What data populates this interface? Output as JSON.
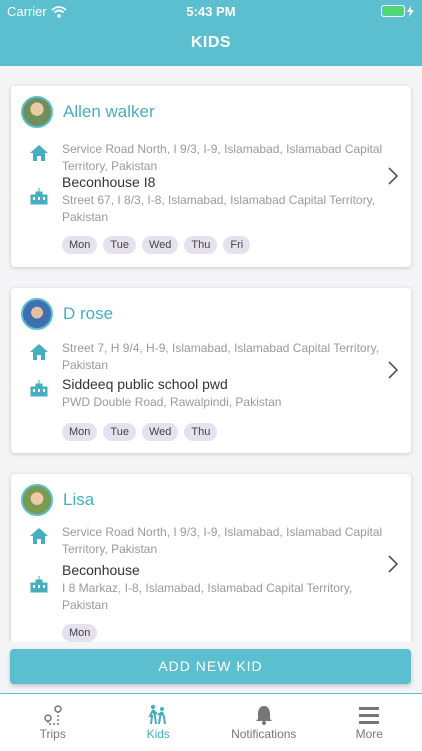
{
  "status_bar": {
    "carrier": "Carrier",
    "time": "5:43 PM"
  },
  "header": {
    "title": "KIDS"
  },
  "kids": [
    {
      "name": "Allen walker",
      "home": {
        "address": "Service Road North, I 9/3, I-9, Islamabad, Islamabad Capital Territory, Pakistan"
      },
      "school": {
        "name": "Beconhouse I8",
        "address": "Street 67, I 8/3, I-8, Islamabad, Islamabad Capital Territory, Pakistan"
      },
      "days": [
        "Mon",
        "Tue",
        "Wed",
        "Thu",
        "Fri"
      ]
    },
    {
      "name": "D rose",
      "home": {
        "address": "Street 7, H 9/4, H-9, Islamabad, Islamabad Capital Territory, Pakistan"
      },
      "school": {
        "name": "Siddeeq public school pwd",
        "address": "PWD Double Road, Rawalpindi, Pakistan"
      },
      "days": [
        "Mon",
        "Tue",
        "Wed",
        "Thu"
      ]
    },
    {
      "name": "Lisa",
      "home": {
        "address": "Service Road North, I 9/3, I-9, Islamabad, Islamabad Capital Territory, Pakistan"
      },
      "school": {
        "name": "Beconhouse",
        "address": "I 8 Markaz, I-8, Islamabad, Islamabad Capital Territory, Pakistan"
      },
      "days": [
        "Mon"
      ]
    }
  ],
  "add_button": {
    "label": "ADD NEW KID"
  },
  "tabs": [
    {
      "label": "Trips",
      "icon": "trips-icon"
    },
    {
      "label": "Kids",
      "icon": "kids-icon"
    },
    {
      "label": "Notifications",
      "icon": "bell-icon"
    },
    {
      "label": "More",
      "icon": "menu-icon"
    }
  ],
  "active_tab": "Kids",
  "colors": {
    "accent": "#5bbfd0",
    "accent_text": "#45aebf",
    "day_chip": "#e6e1ee"
  }
}
